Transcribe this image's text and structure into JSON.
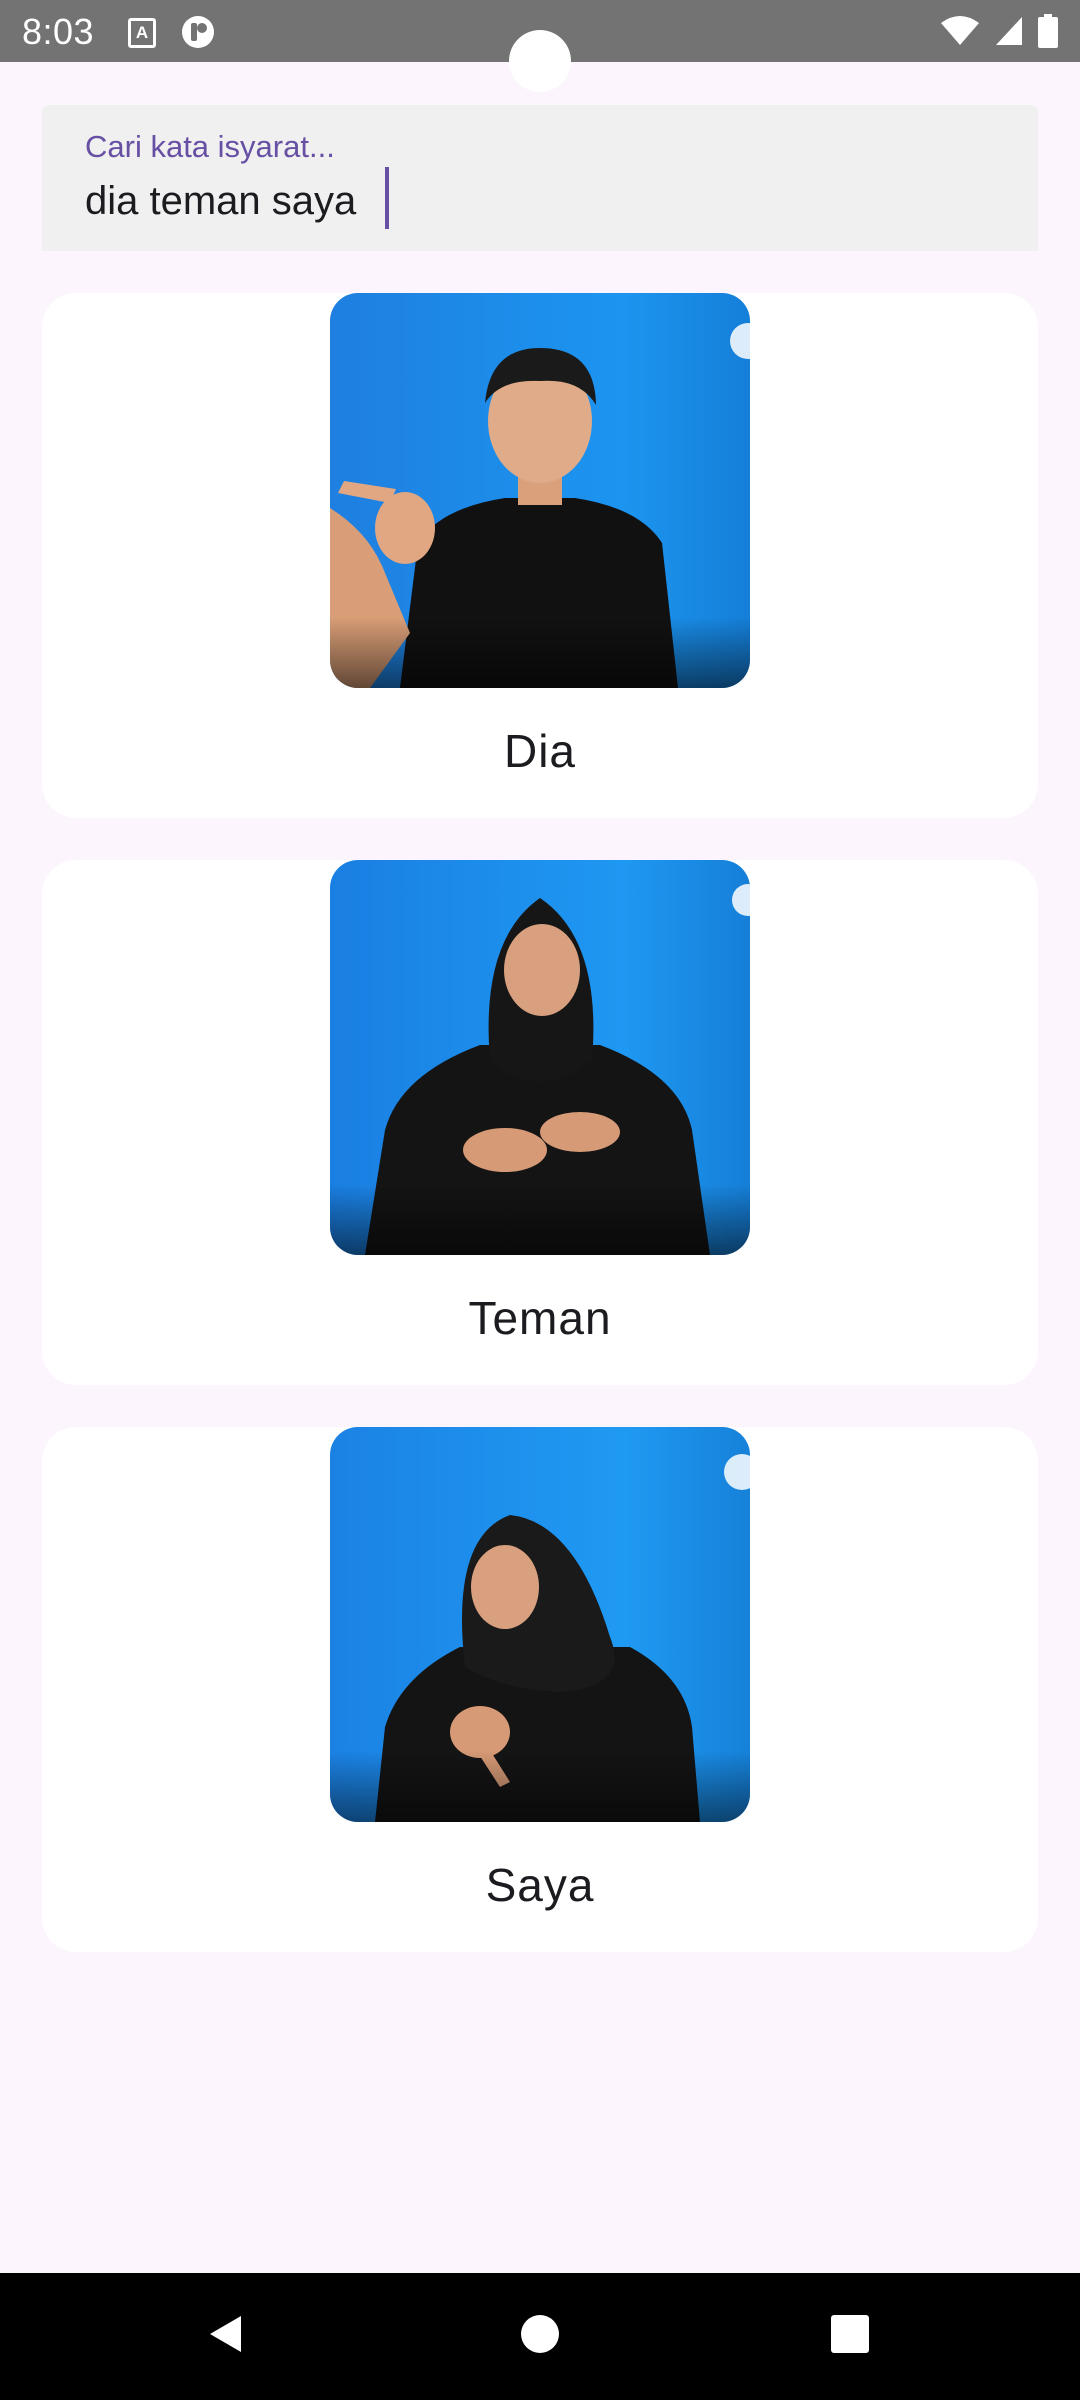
{
  "status_bar": {
    "time": "8:03",
    "notification_a_letter": "A",
    "icons": [
      "wifi-icon",
      "cellular-signal-icon",
      "battery-icon"
    ]
  },
  "search": {
    "label": "Cari kata isyarat...",
    "value": "dia teman saya"
  },
  "signs": [
    {
      "label": "Dia"
    },
    {
      "label": "Teman"
    },
    {
      "label": "Saya"
    }
  ],
  "nav": {
    "icons": [
      "back-icon",
      "home-icon",
      "recents-icon"
    ]
  },
  "colors": {
    "background": "#fcf5fd",
    "accent": "#6750a4",
    "status_bar": "#737373",
    "card": "#ffffff",
    "video_background": "#1b8fe6"
  }
}
